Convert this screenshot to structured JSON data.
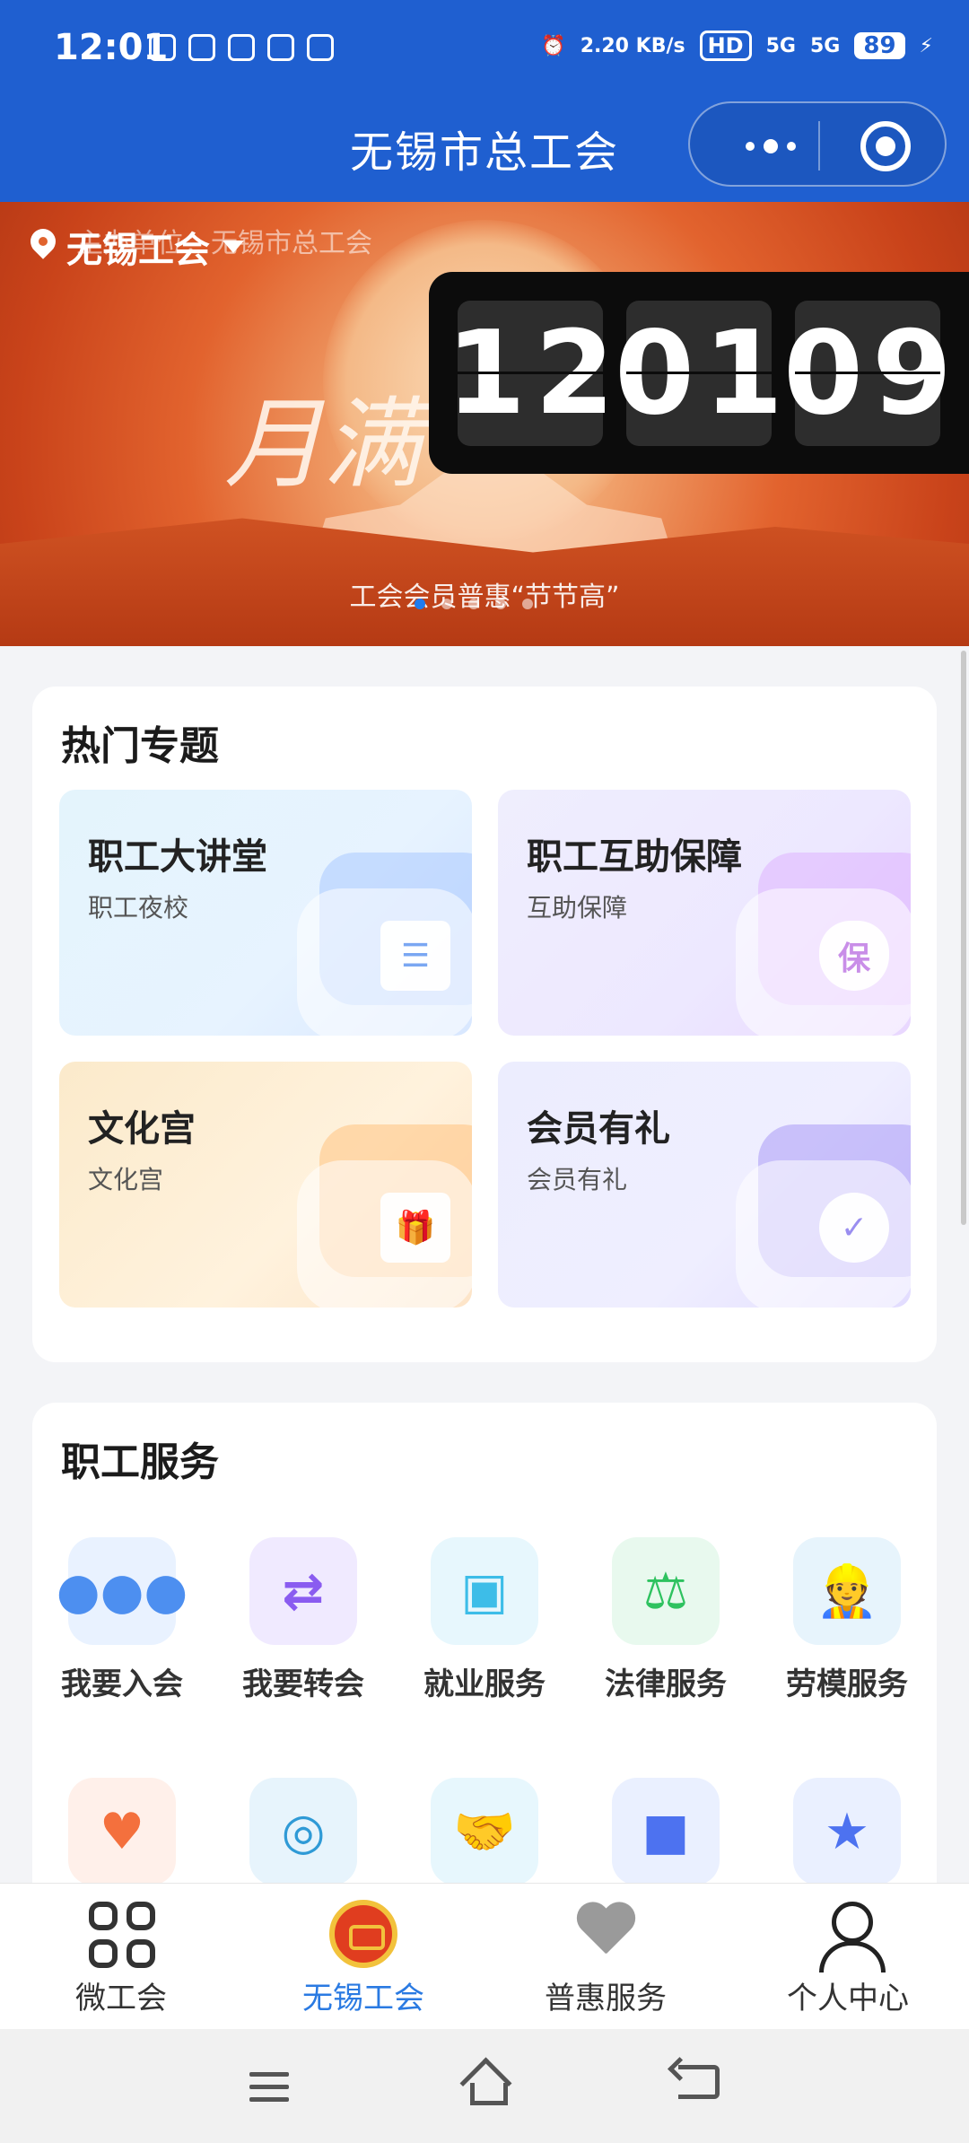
{
  "status_bar": {
    "time": "12:01",
    "net_speed": "2.20 KB/s",
    "hd": "HD",
    "signal1": "5G",
    "signal2": "5G",
    "battery": "89"
  },
  "header": {
    "title": "无锡市总工会"
  },
  "banner": {
    "location_name": "无锡工会",
    "org_line": "主办单位：无锡市总工会",
    "calligraphy": "月满",
    "caption": "工会会员普惠“节节高”",
    "clock_digits": [
      "1",
      "2",
      "0",
      "1",
      "0",
      "9"
    ]
  },
  "hot_topics": {
    "title": "热门专题",
    "tiles": [
      {
        "title": "职工大讲堂",
        "subtitle": "职工夜校",
        "icon": "news-icon"
      },
      {
        "title": "职工互助保障",
        "subtitle": "互助保障",
        "icon": "shield-bao-icon",
        "icon_text": "保"
      },
      {
        "title": "文化宫",
        "subtitle": "文化宫",
        "icon": "gift-icon"
      },
      {
        "title": "会员有礼",
        "subtitle": "会员有礼",
        "icon": "badge-icon"
      }
    ]
  },
  "services": {
    "title": "职工服务",
    "items": [
      {
        "label": "我要入会",
        "icon": "group-icon",
        "color": "#4d8ff0"
      },
      {
        "label": "我要转会",
        "icon": "transfer-user-icon",
        "color": "#8a5cf0"
      },
      {
        "label": "就业服务",
        "icon": "briefcase-icon",
        "color": "#3dbde8"
      },
      {
        "label": "法律服务",
        "icon": "scales-icon",
        "color": "#2ec25f"
      },
      {
        "label": "劳模服务",
        "icon": "worker-icon",
        "color": "#2f9ad6"
      },
      {
        "label": "",
        "icon": "care-hands-icon",
        "color": "#f4703d"
      },
      {
        "label": "",
        "icon": "social-security-icon",
        "color": "#2f9ad6"
      },
      {
        "label": "",
        "icon": "handshake-icon",
        "color": "#3dbde8"
      },
      {
        "label": "",
        "icon": "video-camera-icon",
        "color": "#4d72f0"
      },
      {
        "label": "",
        "icon": "certificate-search-icon",
        "color": "#4d72f0"
      }
    ]
  },
  "tabbar": {
    "tabs": [
      {
        "label": "微工会",
        "icon": "grid-icon",
        "active": false
      },
      {
        "label": "无锡工会",
        "icon": "union-emblem-icon",
        "active": true
      },
      {
        "label": "普惠服务",
        "icon": "heart-icon",
        "active": false
      },
      {
        "label": "个人中心",
        "icon": "user-icon",
        "active": false
      }
    ]
  },
  "colors": {
    "header_bg": "#1f5fd0",
    "active_tab": "#2a7ae2",
    "page_bg": "#f3f4f7"
  }
}
